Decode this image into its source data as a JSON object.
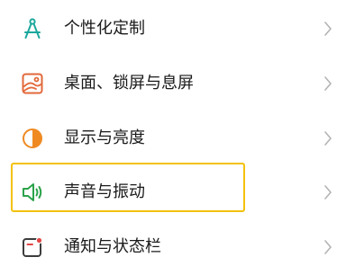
{
  "settings": {
    "items": [
      {
        "label": "个性化定制",
        "icon": "compass-icon",
        "icon_color": "#1aa79c"
      },
      {
        "label": "桌面、锁屏与息屏",
        "icon": "wallpaper-icon",
        "icon_color": "#e2683a"
      },
      {
        "label": "显示与亮度",
        "icon": "brightness-icon",
        "icon_color": "#ef8a22"
      },
      {
        "label": "声音与振动",
        "icon": "speaker-icon",
        "icon_color": "#2ba24a"
      },
      {
        "label": "通知与状态栏",
        "icon": "notification-icon",
        "icon_color": "#e24848"
      }
    ],
    "highlighted_item": "声音与振动",
    "highlight_color": "#f3c20c"
  }
}
